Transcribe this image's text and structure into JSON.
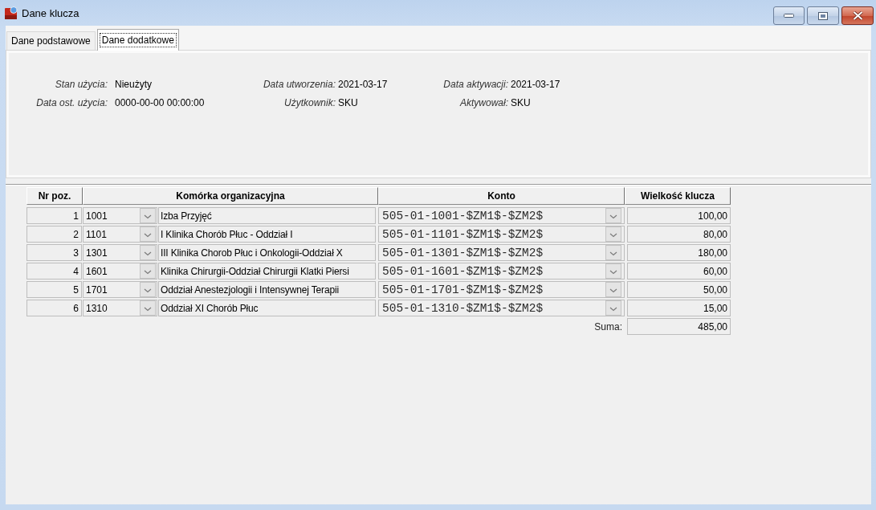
{
  "window": {
    "title": "Dane klucza"
  },
  "tabs": [
    {
      "label": "Dane podstawowe",
      "selected": false
    },
    {
      "label": "Dane dodatkowe",
      "selected": true
    }
  ],
  "details": {
    "rows": [
      [
        {
          "label": "Stan użycia:",
          "value": "Nieużyty"
        },
        {
          "label": "Data utworzenia:",
          "value": "2021-03-17"
        },
        {
          "label": "Data aktywacji:",
          "value": "2021-03-17"
        }
      ],
      [
        {
          "label": "Data ost. użycia:",
          "value": "0000-00-00 00:00:00"
        },
        {
          "label": "Użytkownik:",
          "value": "SKU"
        },
        {
          "label": "Aktywował:",
          "value": "SKU"
        }
      ]
    ]
  },
  "table": {
    "columns": [
      "Nr poz.",
      "Komórka organizacyjna",
      "Konto",
      "Wielkość klucza"
    ],
    "rows": [
      {
        "nr": "1",
        "code": "1001",
        "name": "Izba Przyjęć",
        "account": "505-01-1001-$ZM1$-$ZM2$",
        "value": "100,00"
      },
      {
        "nr": "2",
        "code": "1101",
        "name": "I Klinika Chorób Płuc - Oddział I",
        "account": "505-01-1101-$ZM1$-$ZM2$",
        "value": "80,00"
      },
      {
        "nr": "3",
        "code": "1301",
        "name": "III Klinika Chorob Płuc i Onkologii-Oddział X",
        "account": "505-01-1301-$ZM1$-$ZM2$",
        "value": "180,00"
      },
      {
        "nr": "4",
        "code": "1601",
        "name": "Klinika Chirurgii-Oddział Chirurgii Klatki Piersi",
        "account": "505-01-1601-$ZM1$-$ZM2$",
        "value": "60,00"
      },
      {
        "nr": "5",
        "code": "1701",
        "name": "Oddział Anestezjologii i Intensywnej Terapii",
        "account": "505-01-1701-$ZM1$-$ZM2$",
        "value": "50,00"
      },
      {
        "nr": "6",
        "code": "1310",
        "name": "Oddział XI Chorób Płuc",
        "account": "505-01-1310-$ZM1$-$ZM2$",
        "value": "15,00"
      }
    ],
    "total": {
      "label": "Suma:",
      "value": "485,00"
    }
  }
}
